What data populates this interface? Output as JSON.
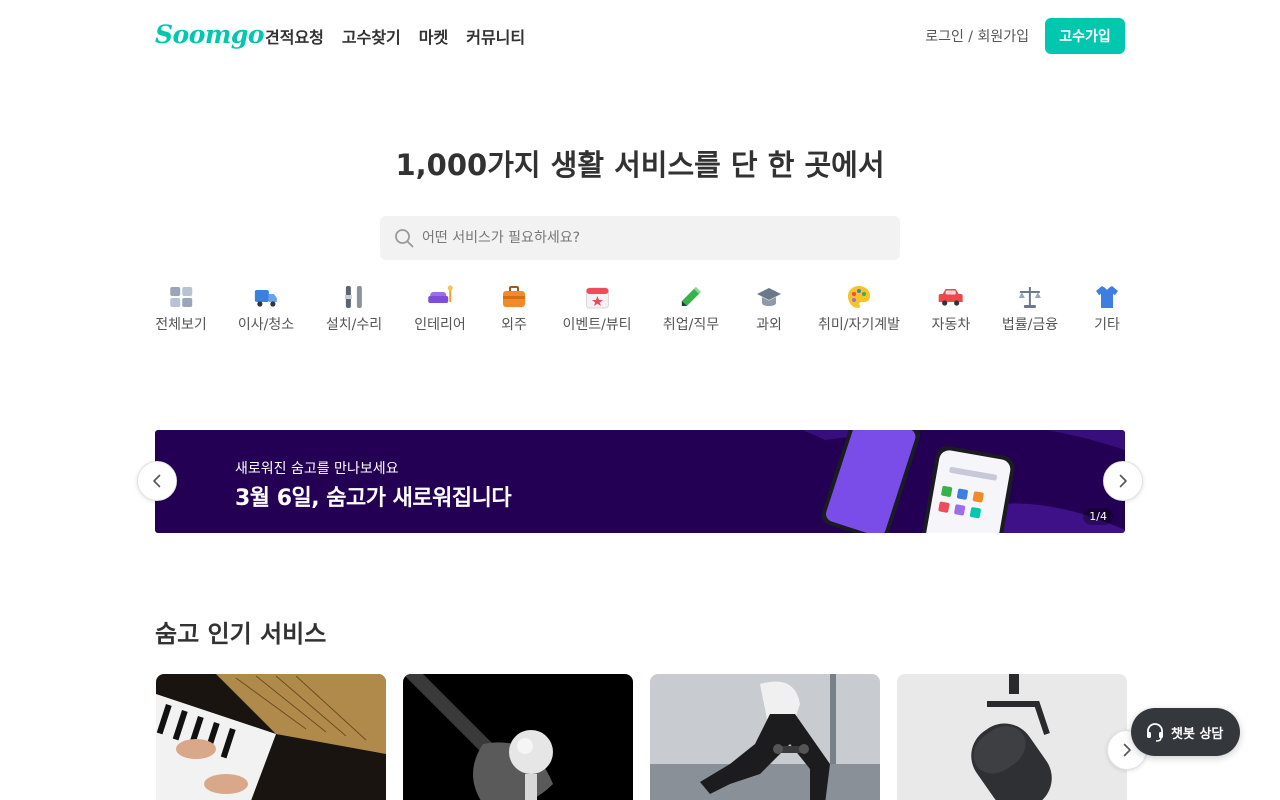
{
  "header": {
    "logo": "Soomgo",
    "nav": [
      "견적요청",
      "고수찾기",
      "마켓",
      "커뮤니티"
    ],
    "login_label": "로그인 / 회원가입",
    "pro_signup_label": "고수가입"
  },
  "hero": {
    "title": "1,000가지 생활 서비스를 단 한 곳에서"
  },
  "search": {
    "placeholder": "어떤 서비스가 필요하세요?"
  },
  "categories": [
    {
      "label": "전체보기",
      "icon": "grid-icon"
    },
    {
      "label": "이사/청소",
      "icon": "truck-icon"
    },
    {
      "label": "설치/수리",
      "icon": "tools-icon"
    },
    {
      "label": "인테리어",
      "icon": "sofa-icon"
    },
    {
      "label": "외주",
      "icon": "briefcase-icon"
    },
    {
      "label": "이벤트/뷰티",
      "icon": "calendar-icon"
    },
    {
      "label": "취업/직무",
      "icon": "pencil-icon"
    },
    {
      "label": "과외",
      "icon": "graduation-cap-icon"
    },
    {
      "label": "취미/자기계발",
      "icon": "palette-icon"
    },
    {
      "label": "자동차",
      "icon": "car-icon"
    },
    {
      "label": "법률/금융",
      "icon": "scale-icon"
    },
    {
      "label": "기타",
      "icon": "shirt-icon"
    }
  ],
  "banner": {
    "subtitle": "새로워진 숨고를 만나보세요",
    "title": "3월 6일, 숨고가 새로워집니다",
    "counter": "1/4",
    "background": "#230053"
  },
  "popular": {
    "title": "숨고 인기 서비스",
    "cards": [
      "piano-photo",
      "golf-photo",
      "fitness-photo",
      "microphone-photo"
    ]
  },
  "chatbot": {
    "label": "챗봇 상담"
  },
  "colors": {
    "brand": "#00c7ae",
    "text": "#323232"
  }
}
